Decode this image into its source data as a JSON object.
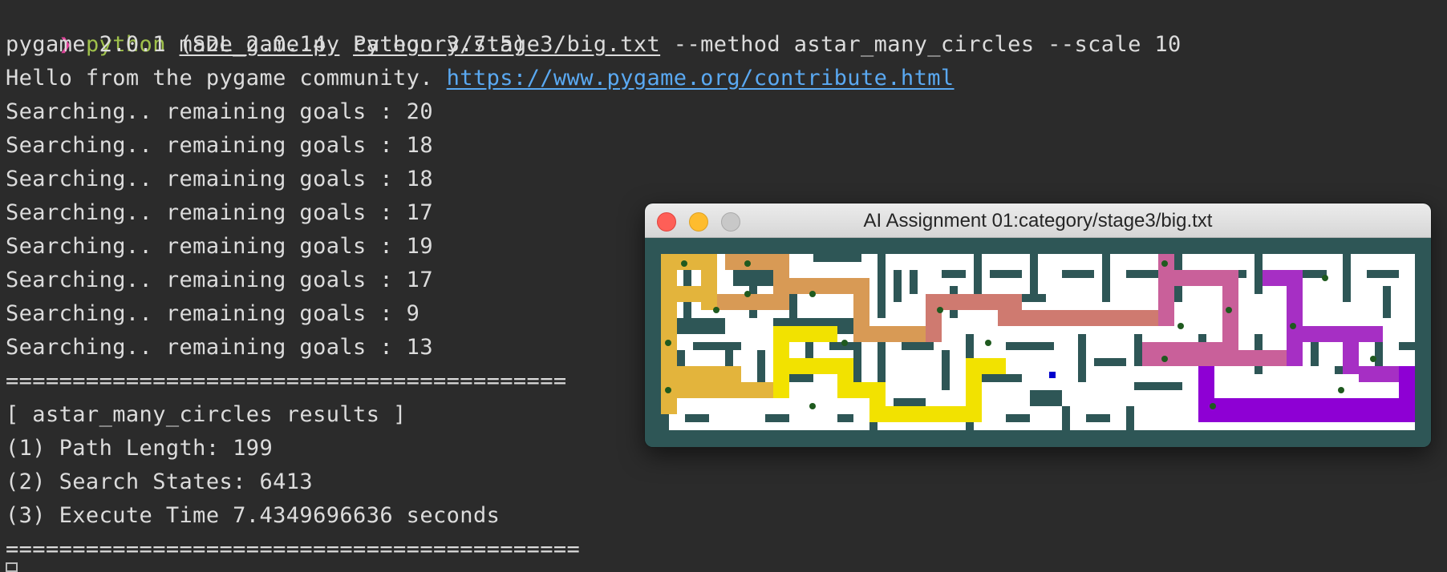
{
  "terminal": {
    "prompt_symbol": "❯",
    "command": {
      "program": "python",
      "script": "maze_game.py",
      "maze_path": "category/stage3/big.txt",
      "options": "--method astar_many_circles --scale 10"
    },
    "pygame_version_line": "pygame 2.0.1 (SDL 2.0.14, Python 3.7.5)",
    "hello_text": "Hello from the pygame community. ",
    "hello_link": "https://www.pygame.org/contribute.html",
    "search_lines": [
      "Searching.. remaining goals : 20",
      "Searching.. remaining goals : 18",
      "Searching.. remaining goals : 18",
      "Searching.. remaining goals : 17",
      "Searching.. remaining goals : 19",
      "Searching.. remaining goals : 17",
      "Searching.. remaining goals : 9",
      "Searching.. remaining goals : 13"
    ],
    "separator": "==========================================",
    "results_header": "[ astar_many_circles results ]",
    "path_length_line": "(1) Path Length: 199",
    "search_states_line": "(2) Search States: 6413",
    "execute_time_line": "(3) Execute Time 7.4349696636 seconds",
    "separator_end": "==========================================="
  },
  "game_window": {
    "title": "AI Assignment 01:category/stage3/big.txt",
    "colors": {
      "background": "#2e5656",
      "wall": "#2e5656",
      "floor": "#ffffff",
      "goal_dot": "#1f5a1f",
      "agent": "#0000cc",
      "path_segments": [
        "#e3b43c",
        "#d89a55",
        "#cf7a70",
        "#c9609a",
        "#f2e200",
        "#a62fc4",
        "#8e00d4"
      ]
    }
  }
}
